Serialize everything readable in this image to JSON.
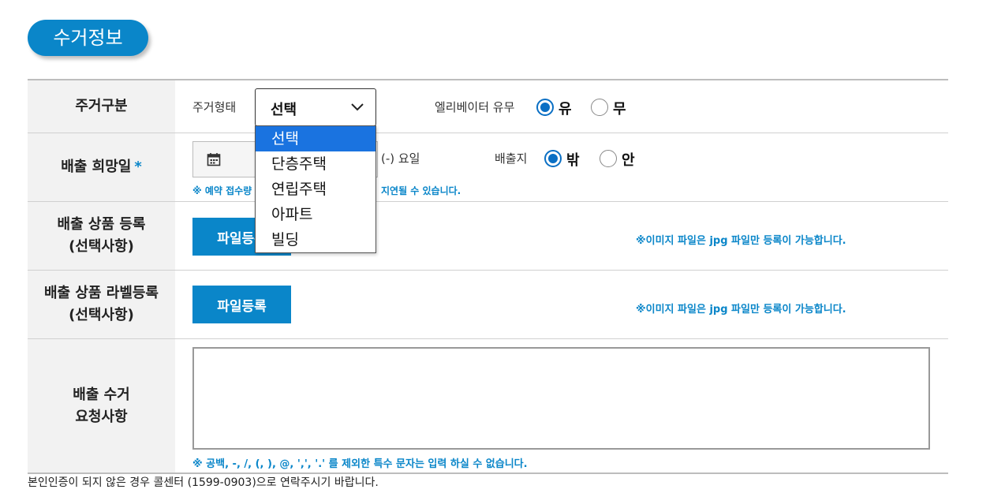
{
  "section": {
    "title": "수거정보"
  },
  "rows": {
    "housing": {
      "label": "주거구분",
      "type_label": "주거형태",
      "select_value": "선택",
      "elevator_label": "엘리베이터 유무",
      "elevator_yes": "유",
      "elevator_no": "무"
    },
    "date": {
      "label": "배출 희망일",
      "required_mark": "*",
      "weekday_text": "(-) 요일",
      "place_label": "배출지",
      "place_out": "밖",
      "place_in": "안",
      "hint_left": "※ 예약 접수량",
      "hint_right": "지연될 수 있습니다."
    },
    "product_upload": {
      "label": "배출 상품 등록\n(선택사항)",
      "button": "파일등록",
      "note": "※이미지 파일은 jpg 파일만 등록이 가능합니다."
    },
    "label_upload": {
      "label": "배출 상품 라벨등록\n(선택사항)",
      "button": "파일등록",
      "note": "※이미지 파일은 jpg 파일만 등록이 가능합니다."
    },
    "request": {
      "label": "배출 수거\n요청사항",
      "textarea_value": "",
      "hint": "※ 공백, -, /, (, ), @, ',', '.' 를 제외한 특수 문자는 입력 하실 수 없습니다."
    }
  },
  "dropdown": {
    "options": [
      "선택",
      "단층주택",
      "연립주택",
      "아파트",
      "빌딩"
    ],
    "selected_index": 0
  },
  "footer": {
    "note": "본인인증이 되지 않은 경우 콜센터 (1599-0903)으로 연락주시기 바랍니다."
  },
  "colors": {
    "accent": "#0a86c9",
    "radio": "#0a6fc4",
    "dropdown_highlight": "#1a73e0"
  },
  "icons": {
    "select": "chevron-down-icon",
    "date": "calendar-icon"
  }
}
